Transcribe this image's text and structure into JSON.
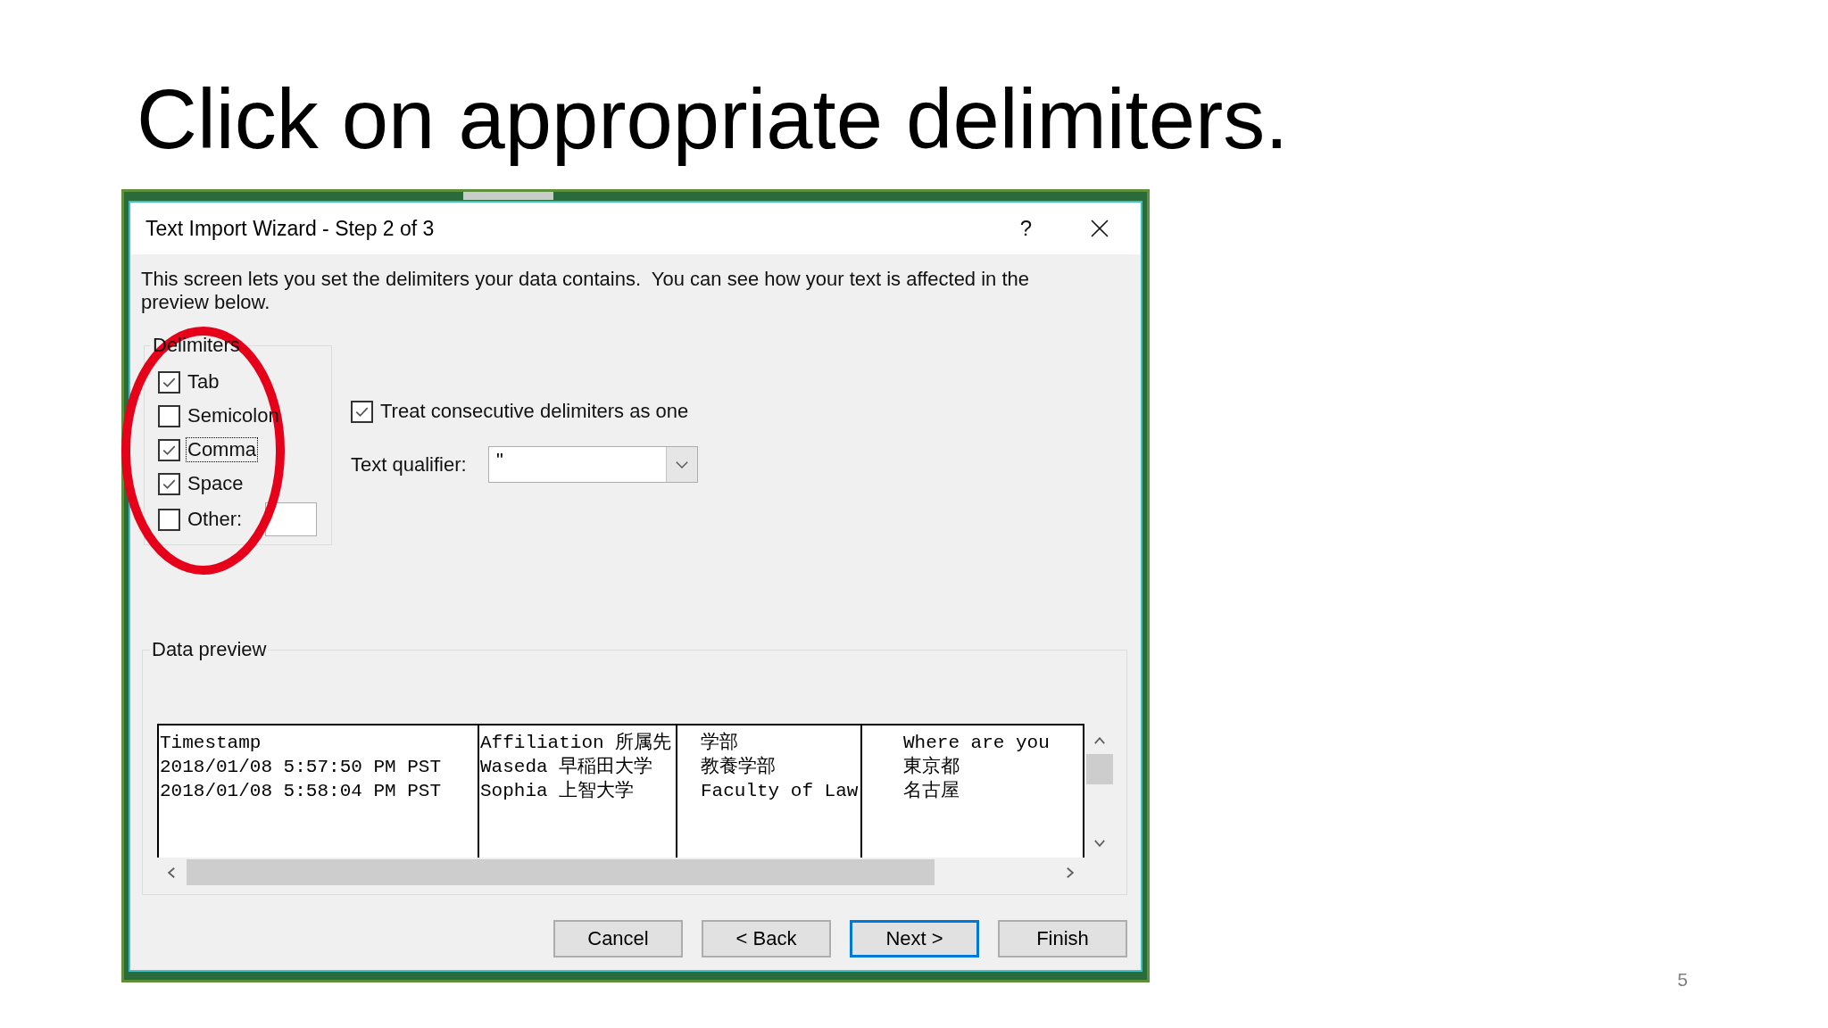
{
  "slide": {
    "title": "Click on appropriate delimiters.",
    "page_number": "5"
  },
  "annotation": {
    "kind": "ellipse"
  },
  "dialog": {
    "title": "Text Import Wizard - Step 2 of 3",
    "help_button": "?",
    "description": "This screen lets you set the delimiters your data contains.  You can see how your text is affected in the preview below.",
    "delimiters": {
      "legend": "Delimiters",
      "items": [
        {
          "kind": "checkbox",
          "label": "Tab",
          "checked": true,
          "focused": false
        },
        {
          "kind": "checkbox",
          "label": "Semicolon",
          "checked": false,
          "focused": false
        },
        {
          "kind": "checkbox",
          "label": "Comma",
          "checked": true,
          "focused": true
        },
        {
          "kind": "checkbox",
          "label": "Space",
          "checked": true,
          "focused": false
        },
        {
          "kind": "checkbox_field",
          "label": "Other:",
          "checked": false,
          "focused": false
        }
      ]
    },
    "treat_consecutive": {
      "label": "Treat consecutive delimiters as one",
      "checked": true
    },
    "text_qualifier": {
      "label": "Text qualifier:",
      "value": "\""
    },
    "data_preview": {
      "legend": "Data preview",
      "rows": [
        [
          "Timestamp",
          "Affiliation 所属先",
          "学部",
          "Where are you"
        ],
        [
          "2018/01/08 5:57:50 PM PST",
          "Waseda 早稲田大学",
          "教養学部",
          "東京都"
        ],
        [
          "2018/01/08 5:58:04 PM PST",
          "Sophia 上智大学",
          "Faculty of Law",
          "名古屋"
        ]
      ]
    },
    "buttons": [
      {
        "label": "Cancel",
        "default": false
      },
      {
        "label": "< Back",
        "default": false
      },
      {
        "label": "Next >",
        "default": true
      },
      {
        "label": "Finish",
        "default": false
      }
    ]
  }
}
